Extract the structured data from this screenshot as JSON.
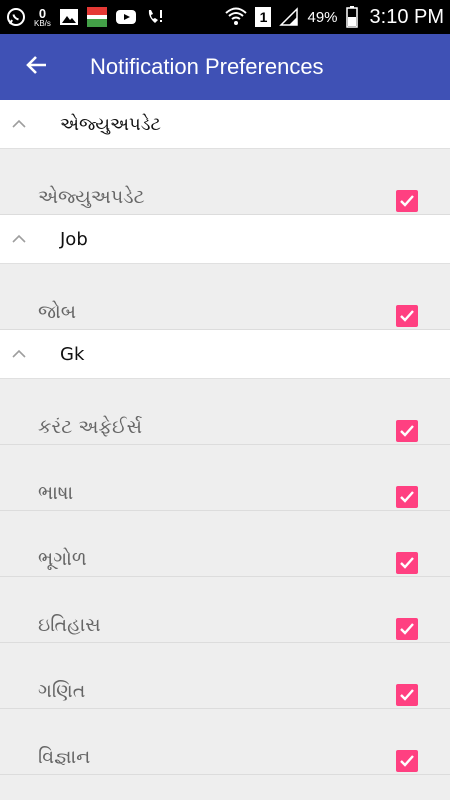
{
  "status_bar": {
    "speed_value": "0",
    "speed_unit": "KB/s",
    "battery_percent": "49%",
    "time": "3:10 PM",
    "sim_label": "1",
    "icons": [
      "whatsapp-icon",
      "image-icon",
      "edu-app-icon",
      "youtube-icon",
      "phone-icon",
      "wifi-icon",
      "signal-icon",
      "battery-icon"
    ]
  },
  "app_bar": {
    "title": "Notification Preferences",
    "back_icon": "arrow-left-icon",
    "background": "#3f51b5"
  },
  "accent_color": "#ff4081",
  "groups": [
    {
      "title": "એજ્યુઅપડેટ",
      "expanded": true,
      "items": [
        {
          "label": "એજ્યુઅપડેટ",
          "checked": true
        }
      ]
    },
    {
      "title": "Job",
      "expanded": true,
      "items": [
        {
          "label": "જોબ",
          "checked": true
        }
      ]
    },
    {
      "title": "Gk",
      "expanded": true,
      "items": [
        {
          "label": "કરંટ અફેઈર્સ",
          "checked": true
        },
        {
          "label": "ભાષા",
          "checked": true
        },
        {
          "label": "ભૂગોળ",
          "checked": true
        },
        {
          "label": "ઇતિહાસ",
          "checked": true
        },
        {
          "label": "ગણિત",
          "checked": true
        },
        {
          "label": "વિજ્ઞાન",
          "checked": true
        }
      ]
    }
  ]
}
